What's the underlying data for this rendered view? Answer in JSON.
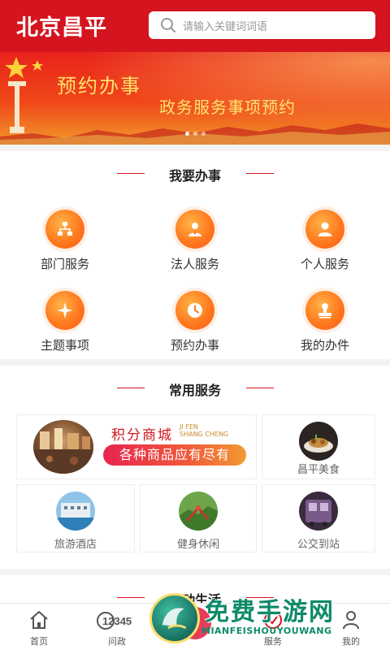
{
  "header": {
    "logo_text": "北京昌平",
    "search_placeholder": "请输入关键词词语"
  },
  "banner": {
    "title": "预约办事",
    "subtitle": "政务服务事项预约",
    "slide_count": 3,
    "active_slide": 1
  },
  "section1": {
    "title": "我要办事",
    "items": [
      {
        "label": "部门服务",
        "icon": "department-icon"
      },
      {
        "label": "法人服务",
        "icon": "legal-person-icon"
      },
      {
        "label": "个人服务",
        "icon": "person-icon"
      },
      {
        "label": "主题事项",
        "icon": "theme-icon"
      },
      {
        "label": "预约办事",
        "icon": "clock-icon"
      },
      {
        "label": "我的办件",
        "icon": "stamp-icon"
      }
    ]
  },
  "section2": {
    "title": "常用服务",
    "mall": {
      "title": "积分商城",
      "pinyin_line1": "JI FEN",
      "pinyin_line2": "SHANG CHENG",
      "slogan": "各种商品应有尽有"
    },
    "tiles": [
      {
        "label": "昌平美食"
      },
      {
        "label": "旅游酒店"
      },
      {
        "label": "健身休闲"
      },
      {
        "label": "公交到站"
      }
    ]
  },
  "section3": {
    "title": "互动生活"
  },
  "nav": {
    "items": [
      {
        "label": "首页",
        "icon": "home-icon"
      },
      {
        "label": "问政",
        "icon": "hotline-12345-icon",
        "icon_text": "12345"
      },
      {
        "label": "",
        "icon": "center-icon"
      },
      {
        "label": "服务",
        "icon": "service-icon"
      },
      {
        "label": "我的",
        "icon": "profile-icon"
      }
    ]
  },
  "watermark": {
    "text": "免费手游网",
    "sub": "MIANFEISHOUYOUWANG"
  },
  "colors": {
    "brand_red": "#d4151f",
    "icon_orange": "#ff7a1f",
    "banner_gold": "#ffe36b"
  }
}
